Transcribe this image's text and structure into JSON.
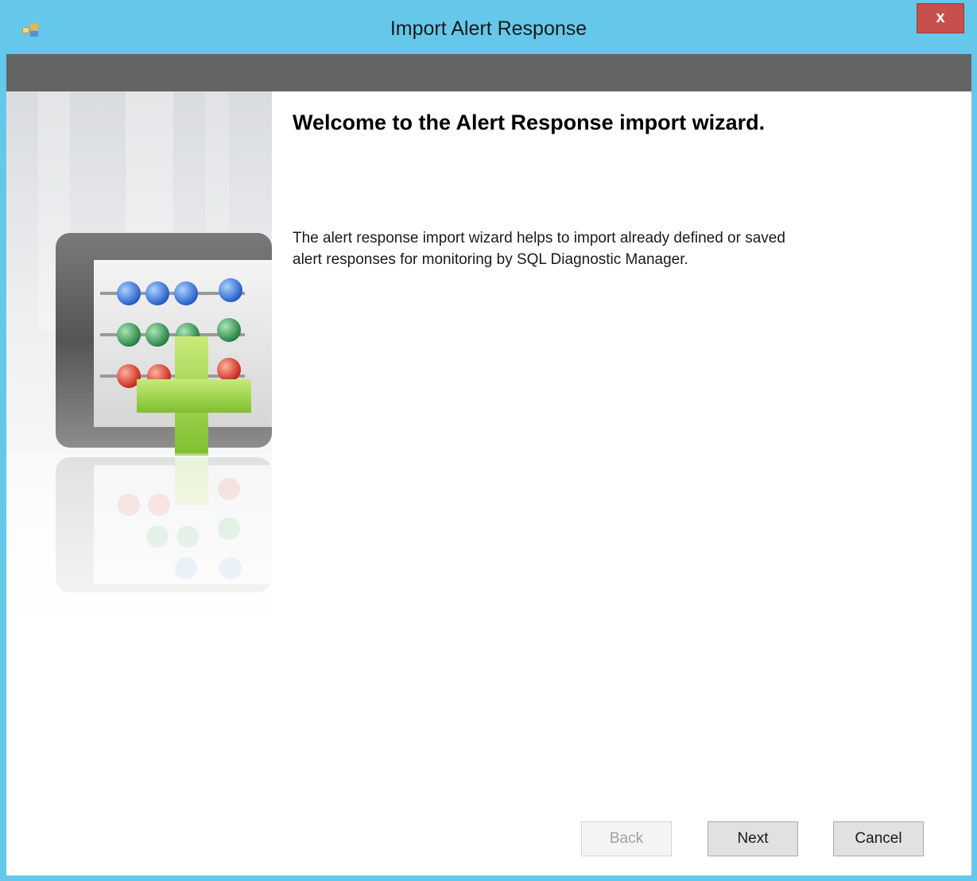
{
  "window": {
    "title": "Import Alert Response",
    "close_label": "x",
    "app_icon": "wizard-app-icon",
    "colors": {
      "titlebar": "#65c8ea",
      "header_band": "#646464",
      "close": "#c7504d"
    }
  },
  "side_panel": {
    "image": "abacus-with-plus-illustration"
  },
  "content": {
    "heading": "Welcome to the Alert Response import wizard.",
    "description_line1": "The alert response import wizard helps to import already defined or saved",
    "description_line2": "alert responses for monitoring by SQL Diagnostic Manager."
  },
  "buttons": {
    "back": "Back",
    "next": "Next",
    "cancel": "Cancel",
    "back_enabled": false
  }
}
